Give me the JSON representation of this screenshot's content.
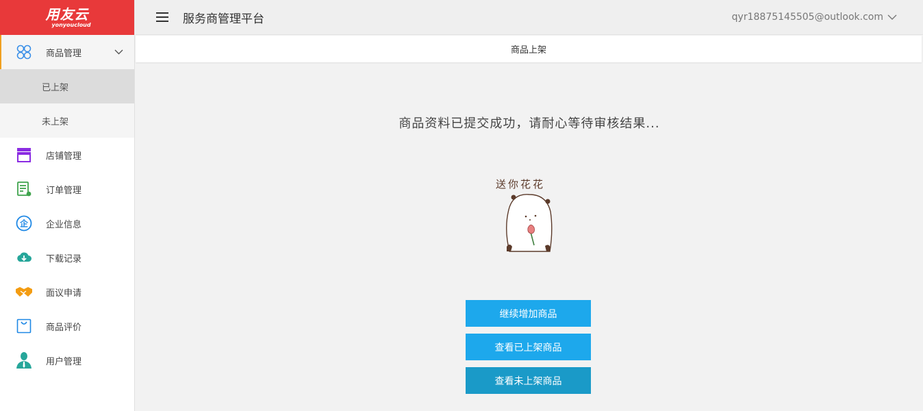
{
  "brand": {
    "logo_cn": "用友云",
    "logo_en": "yonyoucloud",
    "color": "#e8393a"
  },
  "header": {
    "title": "服务商管理平台",
    "user_email": "qyr18875145505@outlook.com"
  },
  "sidebar": {
    "items": [
      {
        "label": "商品管理",
        "icon": "grid-icon",
        "expanded": true,
        "children": [
          {
            "label": "已上架",
            "selected": true
          },
          {
            "label": "未上架",
            "selected": false
          }
        ]
      },
      {
        "label": "店铺管理",
        "icon": "store-icon"
      },
      {
        "label": "订单管理",
        "icon": "order-icon"
      },
      {
        "label": "企业信息",
        "icon": "enterprise-icon"
      },
      {
        "label": "下载记录",
        "icon": "cloud-download-icon"
      },
      {
        "label": "面议申请",
        "icon": "handshake-icon"
      },
      {
        "label": "商品评价",
        "icon": "bag-icon"
      },
      {
        "label": "用户管理",
        "icon": "user-icon"
      }
    ]
  },
  "tab": {
    "label": "商品上架"
  },
  "main": {
    "message": "商品资料已提交成功，请耐心等待审核结果...",
    "sticker_text": "送你花花",
    "buttons": {
      "continue_add": "继续增加商品",
      "view_listed": "查看已上架商品",
      "view_unlisted": "查看未上架商品"
    }
  },
  "colors": {
    "accent_blue": "#1da8ec",
    "accent_blue_dark": "#1a9ac8",
    "active_border": "#f0a020"
  }
}
